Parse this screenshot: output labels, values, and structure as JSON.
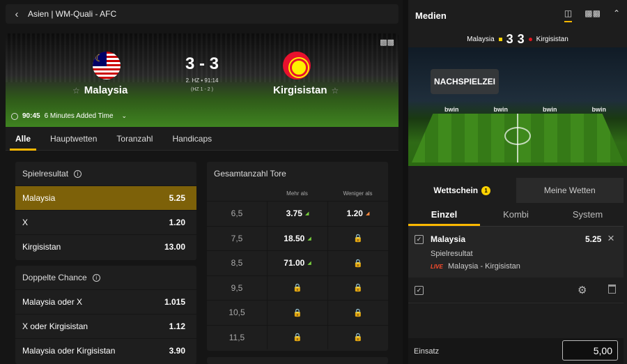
{
  "breadcrumb": {
    "text": "Asien | WM-Quali - AFC"
  },
  "scoreboard": {
    "home": "Malaysia",
    "away": "Kirgisistan",
    "score": "3 - 3",
    "period": "2. HZ • 91:14",
    "halftime": "(HZ 1 - 2 )",
    "clock": "90:45",
    "added_time": "6 Minutes Added Time"
  },
  "tabs": [
    "Alle",
    "Hauptwetten",
    "Toranzahl",
    "Handicaps"
  ],
  "match_result": {
    "title": "Spielresultat",
    "rows": [
      {
        "label": "Malaysia",
        "odd": "5.25"
      },
      {
        "label": "X",
        "odd": "1.20"
      },
      {
        "label": "Kirgisistan",
        "odd": "13.00"
      }
    ]
  },
  "double_chance": {
    "title": "Doppelte Chance",
    "rows": [
      {
        "label": "Malaysia oder X",
        "odd": "1.015"
      },
      {
        "label": "X oder Kirgisistan",
        "odd": "1.12"
      },
      {
        "label": "Malaysia oder Kirgisistan",
        "odd": "3.90"
      }
    ]
  },
  "total_goals": {
    "title": "Gesamtanzahl Tore",
    "over": "Mehr als",
    "under": "Weniger als",
    "rows": [
      {
        "line": "6,5",
        "over": "3.75",
        "under": "1.20"
      },
      {
        "line": "7,5",
        "over": "18.50",
        "under": ""
      },
      {
        "line": "8,5",
        "over": "71.00",
        "under": ""
      },
      {
        "line": "9,5",
        "over": "",
        "under": ""
      },
      {
        "line": "10,5",
        "over": "",
        "under": ""
      },
      {
        "line": "11,5",
        "over": "",
        "under": ""
      }
    ]
  },
  "media": {
    "title": "Medien",
    "home": "Malaysia",
    "away": "Kirgisistan",
    "home_score": "3",
    "away_score": "3",
    "overlay": "NACHSPIELZEI",
    "ads": [
      "bwin",
      "bwin",
      "bwin",
      "bwin"
    ]
  },
  "betslip": {
    "tab_slip": "Wettschein",
    "slip_count": "1",
    "tab_my_bets": "Meine Wetten",
    "modes": [
      "Einzel",
      "Kombi",
      "System"
    ],
    "selection": "Malaysia",
    "odd": "5.25",
    "market": "Spielresultat",
    "live": "LIVE",
    "match": "Malaysia - Kirgisistan",
    "stake_label": "Einsatz",
    "stake_value": "5,00"
  }
}
